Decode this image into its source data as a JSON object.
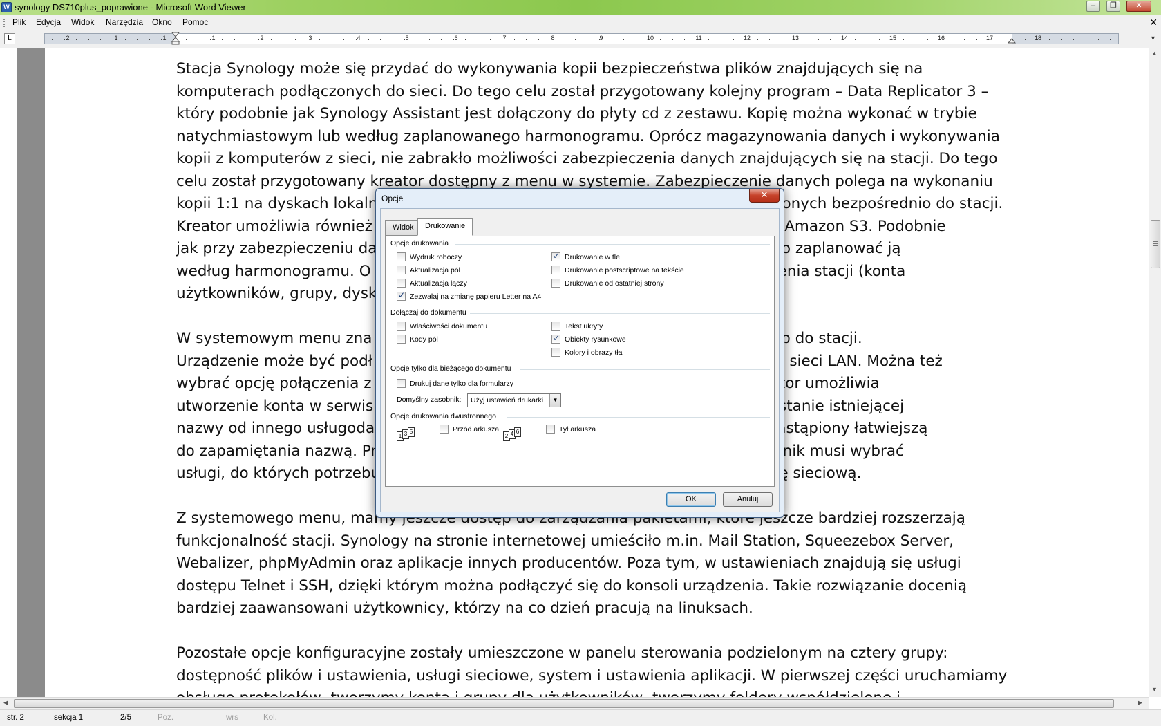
{
  "window": {
    "title": "synology DS710plus_poprawione - Microsoft Word Viewer",
    "icon_name": "word-viewer-icon",
    "controls": [
      "minimize-icon",
      "restore-icon",
      "close-icon"
    ]
  },
  "menu": {
    "items": [
      "Plik",
      "Edycja",
      "Widok",
      "Narzędzia",
      "Okno",
      "Pomoc"
    ],
    "close": "✕"
  },
  "ruler": {
    "tab_selector": "L",
    "numbers": [
      "2",
      "1",
      "1",
      "1",
      "2",
      "3",
      "4",
      "5",
      "6",
      "7",
      "8",
      "9",
      "10",
      "11",
      "12",
      "13",
      "14",
      "15",
      "16",
      "17",
      "18"
    ]
  },
  "document": {
    "lines": [
      "Stacja Synology może się przydać do wykonywania kopii bezpieczeństwa plików znajdujących się na",
      "komputerach podłączonych do sieci. Do tego celu został przygotowany kolejny program – Data Replicator 3 –",
      "który podobnie jak Synology Assistant jest dołączony do płyty cd z zestawu. Kopię można wykonać w trybie",
      "natychmiastowym lub według zaplanowanego harmonogramu. Oprócz magazynowania danych i wykonywania",
      "kopii z komputerów z sieci, nie zabrakło możliwości zabezpieczenia danych znajdujących się na stacji. Do tego",
      "celu został przygotowany kreator dostępny z menu w systemie. Zabezpieczenie danych polega na wykonaniu",
      "kopii 1:1 na dyskach lokalnych, sieciowych lub pamięciach zewnętrznych podłączonych bezpośrednio do stacji.",
      "Kreator umożliwia również                                                                        serwerze Amazon S3. Podobnie",
      "jak przy zabezpieczeniu da                                                                        razu, albo zaplanować ją",
      "według harmonogramu. O                                                                         e ustawienia stacji (konta",
      "użytkowników, grupy, dysk",
      "",
      "W systemowym menu zna                                                                         ny dostęp do stacji.",
      "Urządzenie może być podł                                                                         wego lub sieci LAN. Można też",
      "wybrać opcję połączenia z                                                                         ów. Kreator umożliwia",
      "utworzenie konta w serwis                                                                         wykorzystanie istniejącej",
      "nazwy od innego usługoda                                                                         ostaje zastąpiony łatwiejszą",
      "do zapamiętania nazwą. Pr                                                                         użytkownik musi wybrać",
      "usługi, do których potrzebu                                                                         z zaporę sieciową.",
      "",
      "Z systemowego menu, mamy jeszcze dostęp do zarządzania pakietami, które jeszcze bardziej rozszerzają",
      "funkcjonalność stacji. Synology na stronie internetowej umieściło m.in. Mail Station, Squeezebox Server,",
      "Webalizer, phpMyAdmin oraz aplikacje innych producentów. Poza tym, w ustawieniach znajdują się usługi",
      "dostępu Telnet i SSH, dzięki którym można podłączyć się do konsoli urządzenia. Takie rozwiązanie docenią",
      "bardziej zaawansowani użytkownicy, którzy na co dzień pracują na linuksach.",
      "",
      "Pozostałe opcje konfiguracyjne zostały umieszczone w panelu sterowania podzielonym na cztery grupy:",
      "dostępność plików i ustawienia, usługi sieciowe, system i ustawienia aplikacji. W pierwszej części uruchamiamy",
      "obsługę protokołów, tworzymy konta i grupy dla użytkowników, tworzymy foldery współdzielone i"
    ]
  },
  "status": {
    "page": "str. 2",
    "section": "sekcja 1",
    "pages": "2/5",
    "pos": "Poz.",
    "line": "wrs",
    "col": "Kol."
  },
  "dialog": {
    "title": "Opcje",
    "close": "✕",
    "tabs": [
      "Widok",
      "Drukowanie"
    ],
    "active_tab": "Drukowanie",
    "groups": {
      "print_options": "Opcje drukowania",
      "include": "Dołączaj do dokumentu",
      "current_doc": "Opcje tylko dla bieżącego dokumentu",
      "duplex": "Opcje drukowania dwustronnego"
    },
    "print_options_left": [
      {
        "label": "Wydruk roboczy",
        "checked": false
      },
      {
        "label": "Aktualizacja pól",
        "checked": false
      },
      {
        "label": "Aktualizacja łączy",
        "checked": false
      },
      {
        "label": "Zezwalaj na zmianę papieru Letter na A4",
        "checked": true
      }
    ],
    "print_options_right": [
      {
        "label": "Drukowanie w tle",
        "checked": true
      },
      {
        "label": "Drukowanie postscriptowe na tekście",
        "checked": false
      },
      {
        "label": "Drukowanie od ostatniej strony",
        "checked": false
      }
    ],
    "include_left": [
      {
        "label": "Właściwości dokumentu",
        "checked": false
      },
      {
        "label": "Kody pól",
        "checked": false
      }
    ],
    "include_right": [
      {
        "label": "Tekst ukryty",
        "checked": false
      },
      {
        "label": "Obiekty rysunkowe",
        "checked": true
      },
      {
        "label": "Kolory i obrazy tła",
        "checked": false
      }
    ],
    "current_doc_option": {
      "label": "Drukuj dane tylko dla formularzy",
      "checked": false
    },
    "default_tray_label": "Domyślny zasobnik:",
    "default_tray_value": "Użyj ustawień drukarki",
    "duplex_front": {
      "label": "Przód arkusza",
      "checked": false,
      "pages": [
        "1",
        "3",
        "5"
      ]
    },
    "duplex_back": {
      "label": "Tył arkusza",
      "checked": false,
      "pages": [
        "2",
        "4",
        "6"
      ]
    },
    "ok": "OK",
    "cancel": "Anuluj"
  }
}
